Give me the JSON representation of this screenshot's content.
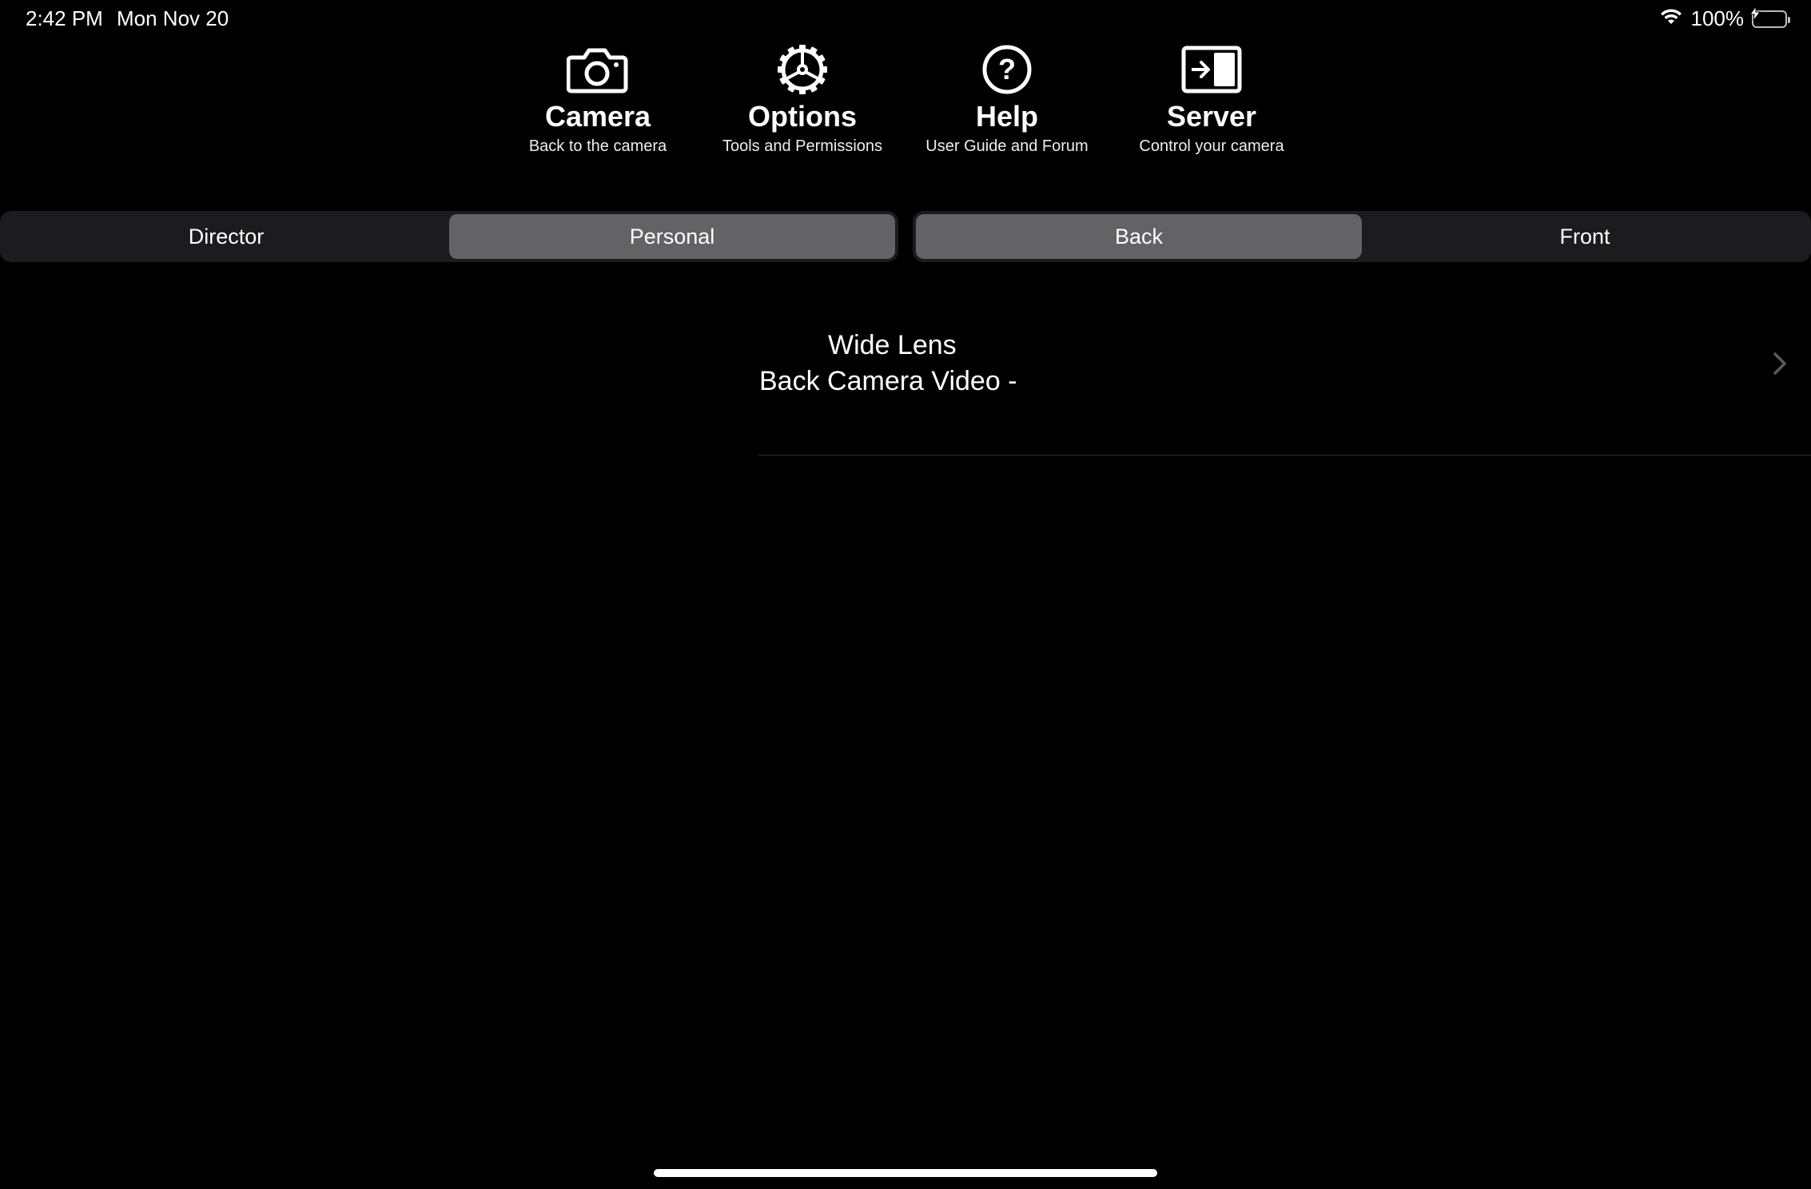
{
  "status_bar": {
    "time": "2:42 PM",
    "date": "Mon Nov 20",
    "battery": "100%",
    "battery_level": 1.0,
    "battery_color": "#34c759"
  },
  "toolbar": {
    "items": [
      {
        "icon": "camera-icon",
        "title": "Camera",
        "subtitle": "Back to the camera"
      },
      {
        "icon": "gear-icon",
        "title": "Options",
        "subtitle": "Tools and Permissions"
      },
      {
        "icon": "question-circle-icon",
        "title": "Help",
        "subtitle": "User Guide and Forum"
      },
      {
        "icon": "server-icon",
        "title": "Server",
        "subtitle": "Control your camera"
      }
    ]
  },
  "mode_segment": {
    "options": [
      "Director",
      "Personal"
    ],
    "selected": "Personal"
  },
  "camera_segment": {
    "options": [
      "Back",
      "Front"
    ],
    "selected": "Back"
  },
  "list": {
    "items": [
      {
        "line1": "Wide Lens",
        "line2": "Back Camera Video -"
      }
    ]
  },
  "colors": {
    "background": "#000000",
    "segment_background": "#1c1c1e",
    "segment_selected": "#636366"
  }
}
